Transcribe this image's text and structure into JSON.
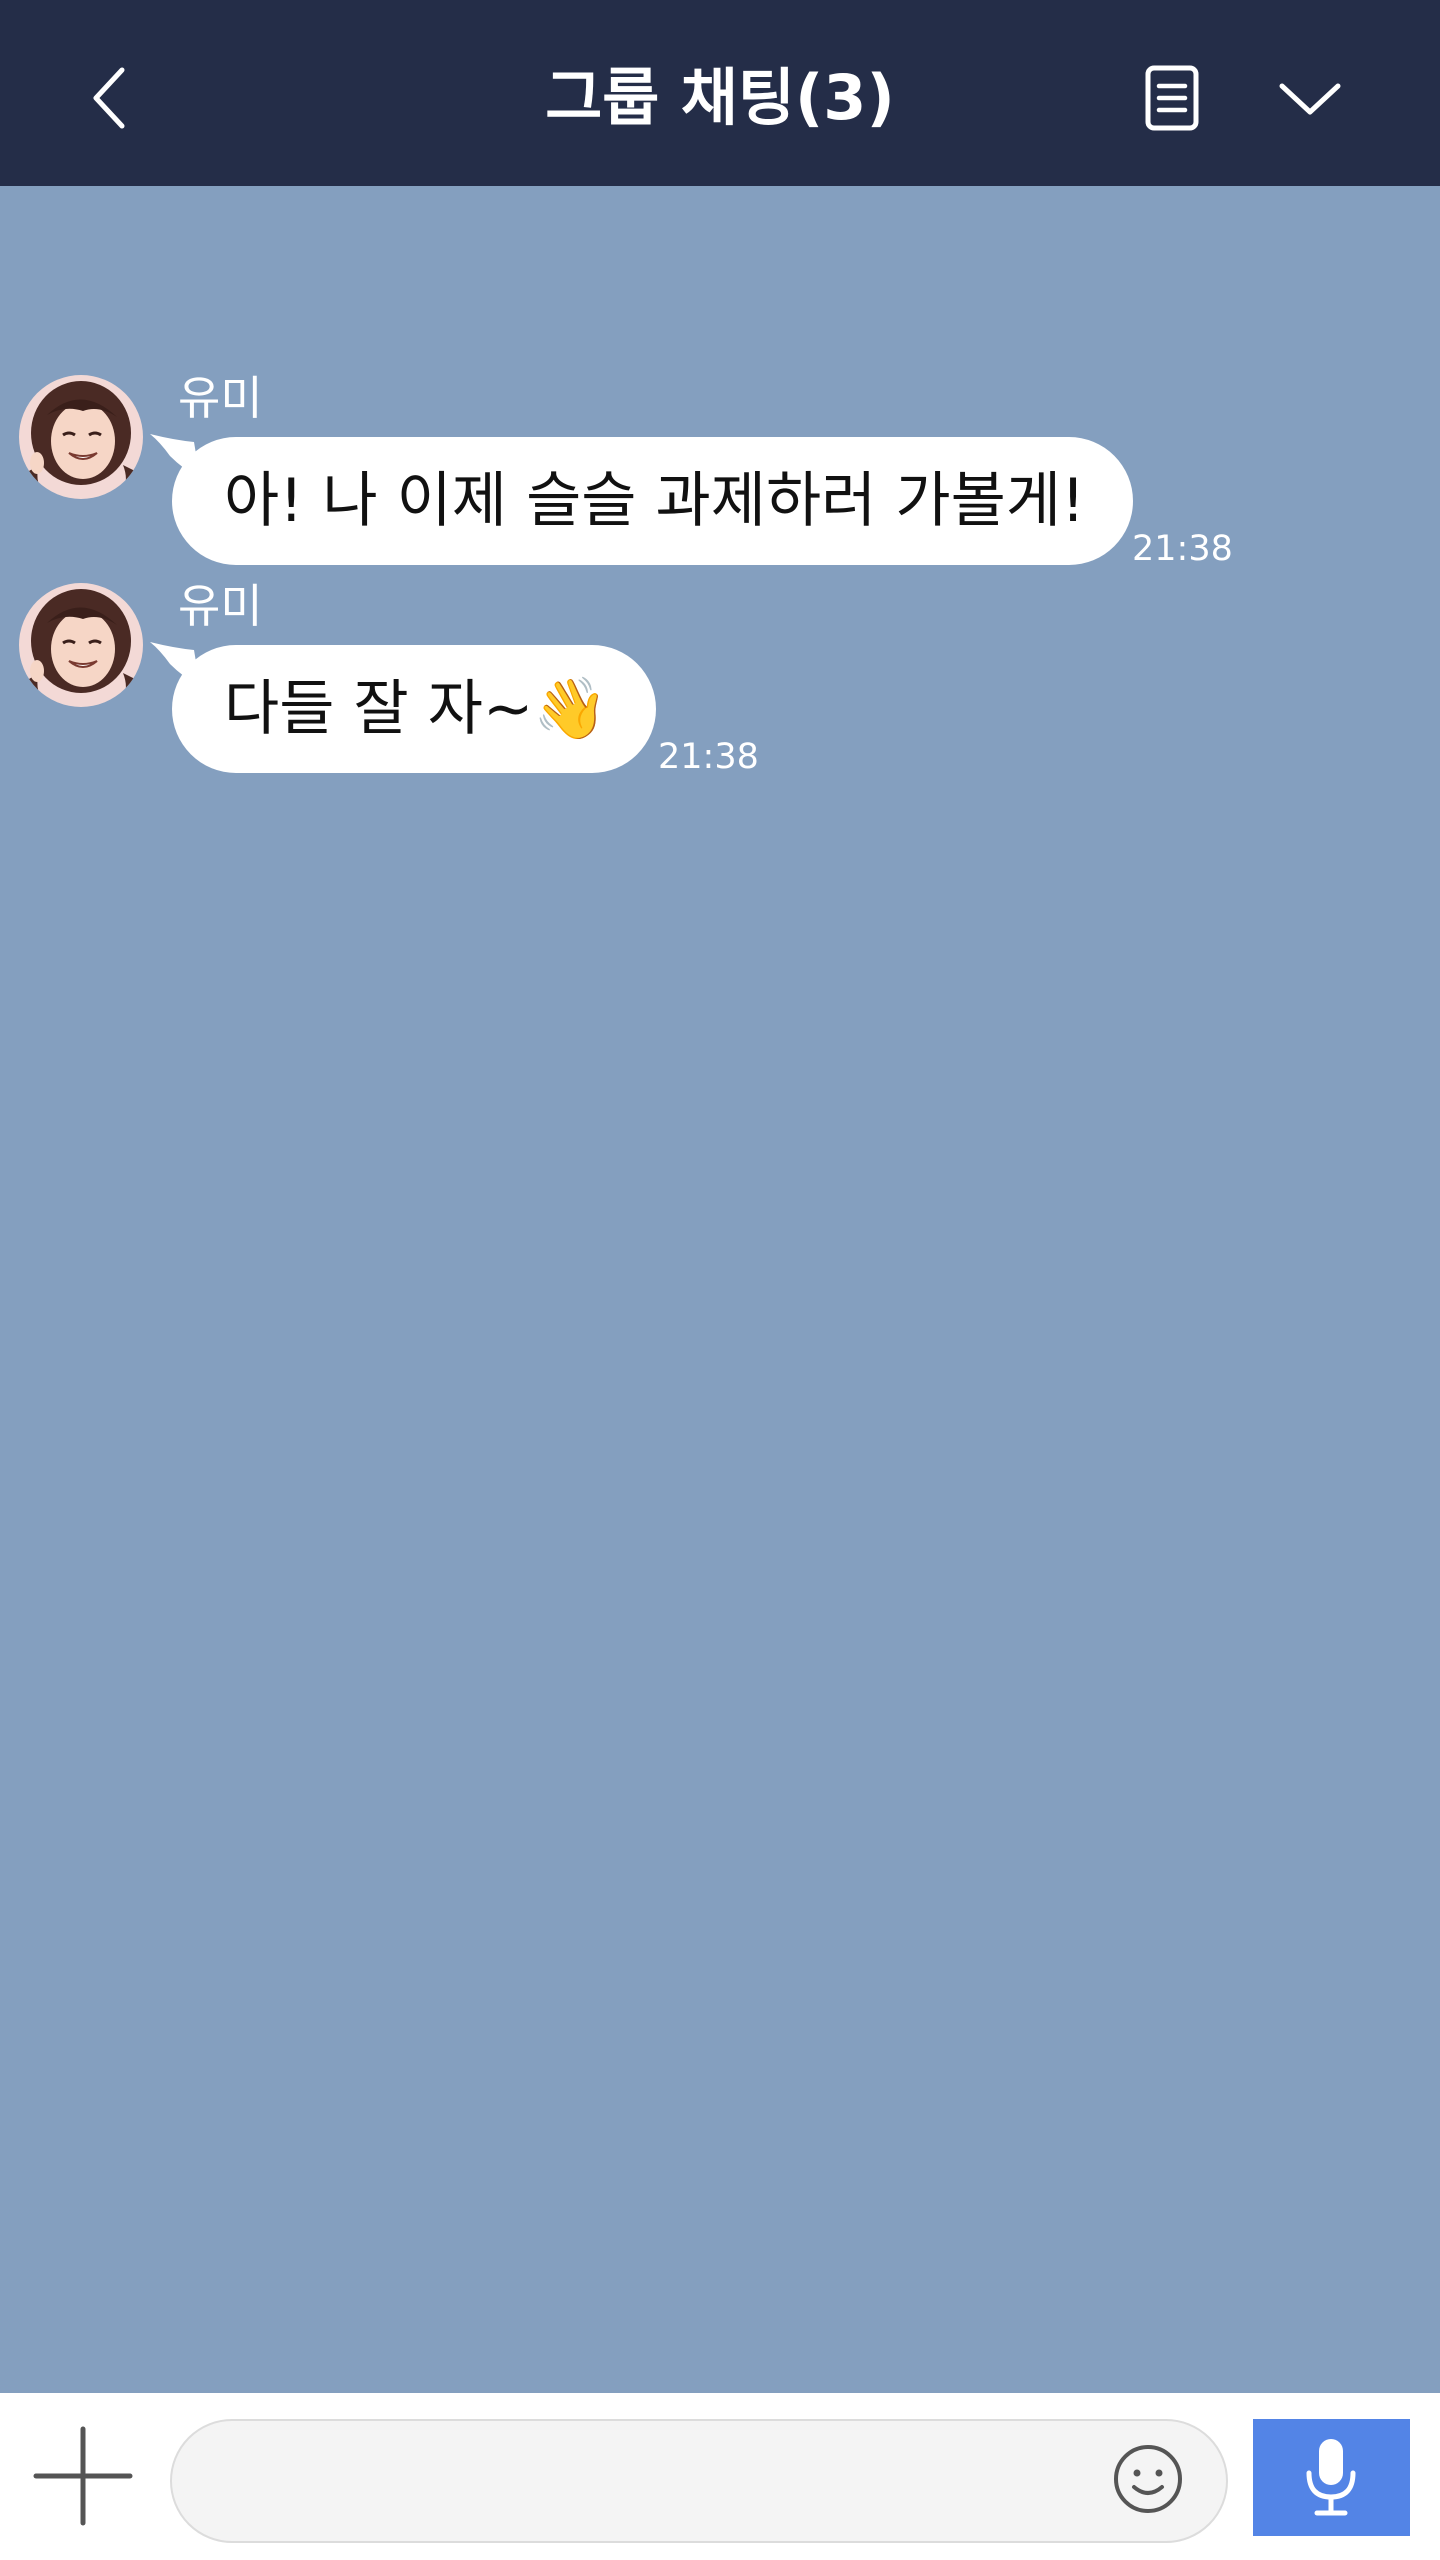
{
  "header": {
    "title": "그룹 채팅(3)",
    "back_icon": "chevron-left-icon",
    "notes_icon": "document-icon",
    "menu_icon": "chevron-down-icon",
    "background": "#242d48"
  },
  "chat": {
    "background": "#849fbf",
    "messages": [
      {
        "sender": "유미",
        "text": "아! 나 이제 슬슬 과제하러 가볼게!",
        "time": "21:38"
      },
      {
        "sender": "유미",
        "text": "다들 잘 자~👋",
        "time": "21:38"
      }
    ]
  },
  "input_bar": {
    "value": "",
    "placeholder": "",
    "plus_icon": "plus-icon",
    "emoji_icon": "smiley-icon",
    "mic_icon": "microphone-icon",
    "mic_color": "#5384e6"
  }
}
